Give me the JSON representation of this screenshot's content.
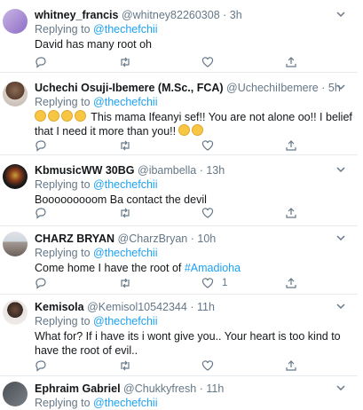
{
  "replying_label": "Replying to",
  "replying_handle": "@thechefchii",
  "tweets": [
    {
      "name": "whitney_francis",
      "handle": "@whitney82260308",
      "sep": "·",
      "time": "3h",
      "text": "David has many root oh",
      "retweets": "",
      "likes": ""
    },
    {
      "name": "Uchechi Osuji-Ibemere (M.Sc., FCA)",
      "handle": "@UchechiIbemere",
      "sep": "·",
      "time": "5h",
      "text_a": "This mama Ifeanyi sef!! You are not alone oo!! I belief that I need it more than you!!",
      "retweets": "",
      "likes": ""
    },
    {
      "name": "KbmusicWW 30BG",
      "handle": "@ibambella",
      "sep": "·",
      "time": "13h",
      "text": "Booooooooom Ba contact the devil",
      "retweets": "",
      "likes": ""
    },
    {
      "name": "CHARZ BRYAN",
      "handle": "@CharzBryan",
      "sep": "·",
      "time": "10h",
      "text_pre": "Come home I have the root of ",
      "hashtag": "#Amadioha",
      "retweets": "",
      "likes": "1"
    },
    {
      "name": "Kemisola",
      "handle": "@Kemisol10542344",
      "sep": "·",
      "time": "11h",
      "text": "What for? If i have its i wont give you..  Your heart is too kind to have the root of evil..",
      "retweets": "",
      "likes": ""
    },
    {
      "name": "Ephraim Gabriel",
      "handle": "@Chukkyfresh",
      "sep": "·",
      "time": "11h",
      "text": "",
      "retweets": "",
      "likes": ""
    }
  ],
  "icons": [
    "chevron-down-icon",
    "reply-icon",
    "retweet-icon",
    "like-icon",
    "share-icon"
  ],
  "colors": {
    "link": "#1da1f2",
    "muted": "#657786",
    "border": "#e6ecf0",
    "text": "#14171a"
  }
}
